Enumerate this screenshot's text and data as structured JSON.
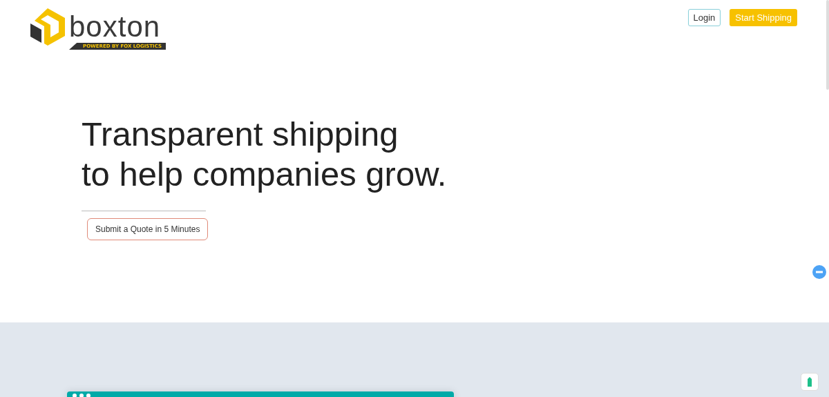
{
  "logo": {
    "name": "boxton",
    "tagline": "POWERED BY FOX LOGISTICS"
  },
  "nav": {
    "login": "Login",
    "cta": "Start Shipping"
  },
  "hero": {
    "headline_lines": [
      "Transparent shipping",
      "to help companies grow."
    ],
    "button": "Submit a Quote in 5 Minutes"
  }
}
